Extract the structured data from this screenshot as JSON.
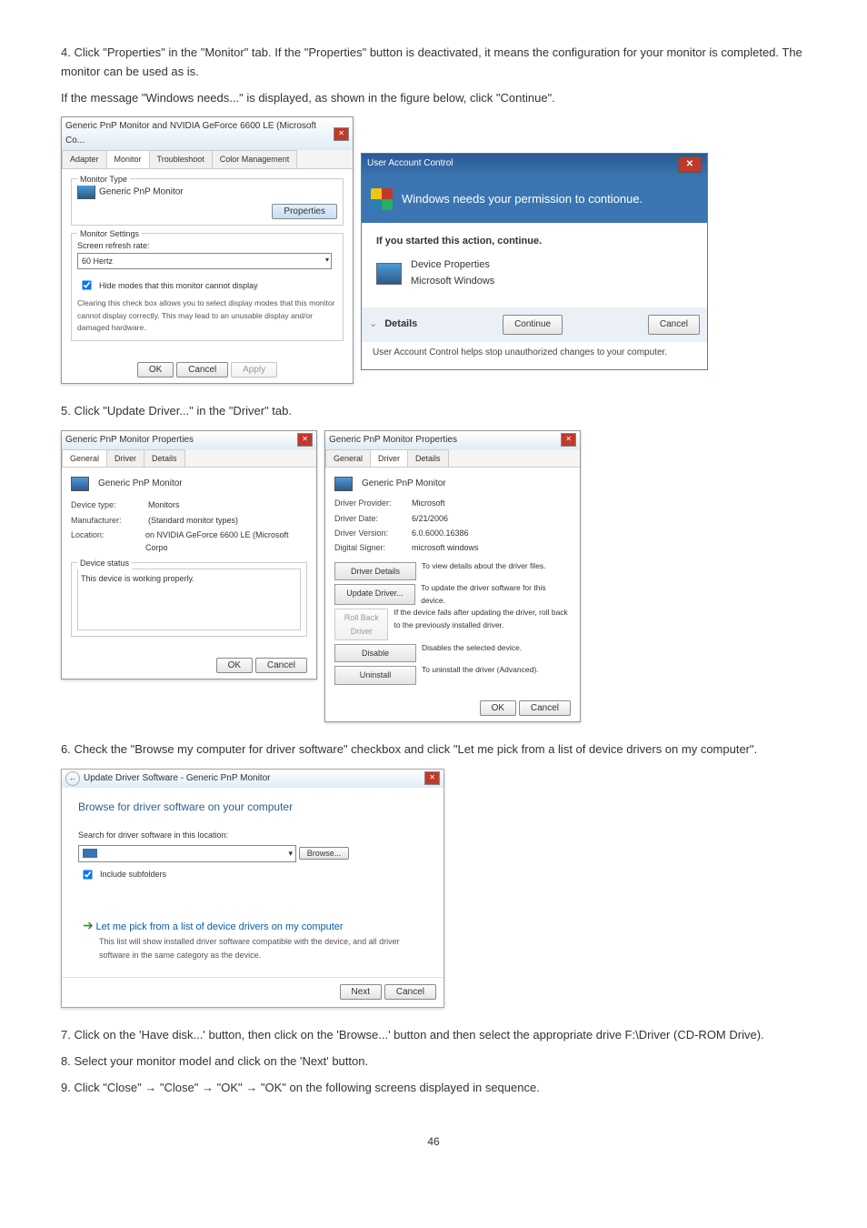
{
  "step4": {
    "text_a": "4. Click \"Properties\" in the \"Monitor\" tab. If the \"Properties\" button is deactivated, it means the configuration for your monitor is completed. The monitor can be used as is.",
    "text_b": "If the message \"Windows needs...\" is displayed, as shown in the figure below, click \"Continue\"."
  },
  "monitor_dialog": {
    "title": "Generic PnP Monitor and NVIDIA GeForce 6600 LE (Microsoft Co...",
    "tabs": [
      "Adapter",
      "Monitor",
      "Troubleshoot",
      "Color Management"
    ],
    "active_tab": 1,
    "group_type": "Monitor Type",
    "type_value": "Generic PnP Monitor",
    "properties_btn": "Properties",
    "group_settings": "Monitor Settings",
    "refresh_label": "Screen refresh rate:",
    "refresh_value": "60 Hertz",
    "hide_check": "Hide modes that this monitor cannot display",
    "hide_desc": "Clearing this check box allows you to select display modes that this monitor cannot display correctly. This may lead to an unusable display and/or damaged hardware.",
    "ok": "OK",
    "cancel": "Cancel",
    "apply": "Apply"
  },
  "uac": {
    "title": "User Account Control",
    "banner": "Windows needs your permission to contionue.",
    "started": "If you started this action, continue.",
    "prop_name": "Device Properties",
    "prop_pub": "Microsoft Windows",
    "details": "Details",
    "continue": "Continue",
    "cancel": "Cancel",
    "note": "User Account Control helps stop unauthorized changes to your computer."
  },
  "step5": "5. Click \"Update Driver...\" in the \"Driver\" tab.",
  "general_tab": {
    "title": "Generic PnP Monitor Properties",
    "tabs": [
      "General",
      "Driver",
      "Details"
    ],
    "active_tab": 0,
    "heading": "Generic PnP Monitor",
    "labels": {
      "device_type_k": "Device type:",
      "device_type_v": "Monitors",
      "manufacturer_k": "Manufacturer:",
      "manufacturer_v": "(Standard monitor types)",
      "location_k": "Location:",
      "location_v": "on NVIDIA GeForce 6600 LE (Microsoft Corpo",
      "status_group": "Device status",
      "status_text": "This device is working properly."
    },
    "ok": "OK",
    "cancel": "Cancel"
  },
  "driver_tab": {
    "title": "Generic PnP Monitor Properties",
    "tabs": [
      "General",
      "Driver",
      "Details"
    ],
    "active_tab": 1,
    "heading": "Generic PnP Monitor",
    "labels": {
      "provider_k": "Driver Provider:",
      "provider_v": "Microsoft",
      "date_k": "Driver Date:",
      "date_v": "6/21/2006",
      "version_k": "Driver Version:",
      "version_v": "6.0.6000.16386",
      "signer_k": "Digital Signer:",
      "signer_v": "microsoft windows"
    },
    "buttons": {
      "details": "Driver Details",
      "details_d": "To view details about the driver files.",
      "update": "Update Driver...",
      "update_d": "To update the driver software for this device.",
      "rollback": "Roll Back Driver",
      "rollback_d": "If the device fails after updating the driver, roll back to the previously installed driver.",
      "disable": "Disable",
      "disable_d": "Disables the selected device.",
      "uninstall": "Uninstall",
      "uninstall_d": "To uninstall the driver (Advanced)."
    },
    "ok": "OK",
    "cancel": "Cancel"
  },
  "step6": "6. Check the \"Browse my computer for driver software\" checkbox and click \"Let me pick from a list of device drivers on my computer\".",
  "wizard": {
    "title": "Update Driver Software - Generic PnP Monitor",
    "heading": "Browse for driver software on your computer",
    "search_label": "Search for driver software in this location:",
    "path": "",
    "browse": "Browse...",
    "include_sub": "Include subfolders",
    "pick_label": "Let me pick from a list of device drivers on my computer",
    "pick_desc": "This list will show installed driver software compatible with the device, and all driver software in the same category as the device.",
    "next": "Next",
    "cancel": "Cancel"
  },
  "step7": "7. Click on the 'Have disk...' button, then click on the 'Browse...' button and then select the appropriate drive F:\\Driver (CD-ROM Drive).",
  "step8": "8. Select your monitor model and click on the 'Next' button.",
  "step9": "9. Click \"Close\"  →  \"Close\"  →  \"OK\"  →  \"OK\" on the following screens displayed in sequence.",
  "page_num": "46"
}
